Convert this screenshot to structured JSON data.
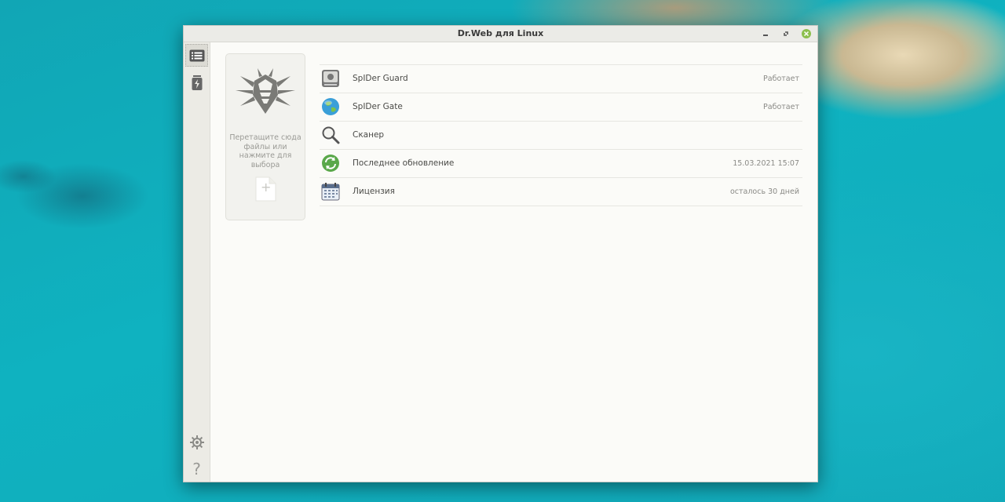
{
  "window": {
    "title": "Dr.Web для Linux"
  },
  "sidebar": {
    "items": [
      {
        "name": "main-menu",
        "icon": "list-icon"
      },
      {
        "name": "threats",
        "icon": "quarantine-icon"
      }
    ],
    "bottom": [
      {
        "name": "settings",
        "icon": "gear-icon"
      },
      {
        "name": "help",
        "icon": "question-icon",
        "glyph": "?"
      }
    ]
  },
  "dropzone": {
    "hint": "Перетащите сюда файлы или нажмите для выбора",
    "logo": "drweb-spider-logo",
    "add_glyph": "+"
  },
  "components": [
    {
      "label": "SpIDer Guard",
      "status": "Работает",
      "icon": "spider-guard-icon"
    },
    {
      "label": "SpIDer Gate",
      "status": "Работает",
      "icon": "globe-icon"
    },
    {
      "label": "Сканер",
      "status": "",
      "icon": "magnifier-icon"
    },
    {
      "label": "Последнее обновление",
      "status": "15.03.2021 15:07",
      "icon": "update-icon"
    },
    {
      "label": "Лицензия",
      "status": "осталось 30 дней",
      "icon": "calendar-icon"
    }
  ],
  "colors": {
    "close_button": "#8cbf4e",
    "accent_green": "#5aa84a"
  }
}
